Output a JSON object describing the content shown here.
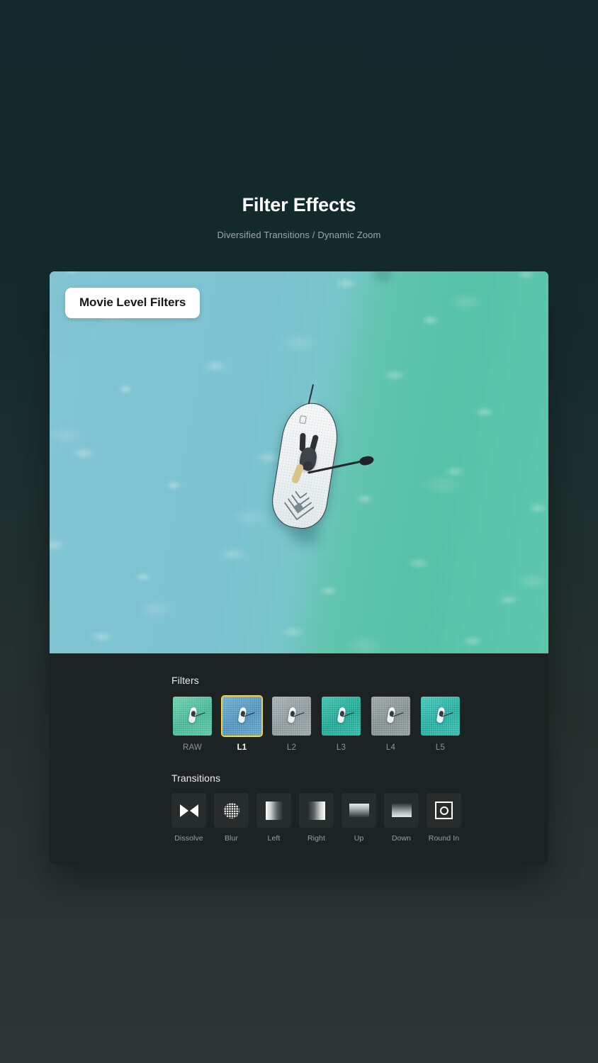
{
  "header": {
    "title": "Filter Effects",
    "subtitle": "Diversified Transitions / Dynamic Zoom"
  },
  "preview": {
    "badge_label": "Movie Level Filters",
    "photo_alt": "Aerial view of a paddleboarder on a white stand-up paddle board over turquoise ocean water"
  },
  "filters": {
    "section_label": "Filters",
    "selected": "L1",
    "items": [
      {
        "label": "RAW",
        "color": "#55bfa0",
        "selected": false
      },
      {
        "label": "L1",
        "color": "#5a9fc4",
        "selected": true
      },
      {
        "label": "L2",
        "color": "#98a3a6",
        "selected": false
      },
      {
        "label": "L3",
        "color": "#2bb2a0",
        "selected": false
      },
      {
        "label": "L4",
        "color": "#8f9a9c",
        "selected": false
      },
      {
        "label": "L5",
        "color": "#34b7aa",
        "selected": false
      }
    ]
  },
  "transitions": {
    "section_label": "Transitions",
    "items": [
      {
        "label": "Dissolve",
        "icon": "dissolve-icon"
      },
      {
        "label": "Blur",
        "icon": "blur-icon"
      },
      {
        "label": "Left",
        "icon": "wipe-left-icon"
      },
      {
        "label": "Right",
        "icon": "wipe-right-icon"
      },
      {
        "label": "Up",
        "icon": "wipe-up-icon"
      },
      {
        "label": "Down",
        "icon": "wipe-down-icon"
      },
      {
        "label": "Round In",
        "icon": "round-in-icon"
      }
    ]
  },
  "colors": {
    "accent_selected": "#ffd23a",
    "background_top": "#11292a",
    "background_bottom": "#2e3434",
    "panel": "#1d2222",
    "badge_bg": "#ffffff"
  }
}
